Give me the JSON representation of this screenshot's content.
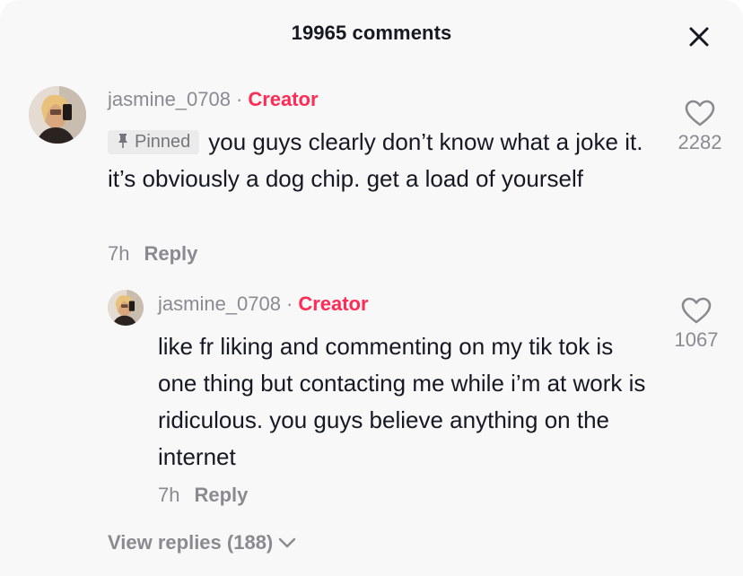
{
  "header": {
    "title": "19965 comments",
    "close_icon": "close-icon"
  },
  "comments": [
    {
      "username": "jasmine_0708",
      "separator": "·",
      "role": "Creator",
      "pinned_label": "Pinned",
      "text": "you guys clearly don’t know what a joke it. it’s obviously a dog chip. get a load of yourself",
      "time": "7h",
      "reply_label": "Reply",
      "likes": "2282"
    }
  ],
  "reply": {
    "username": "jasmine_0708",
    "separator": "·",
    "role": "Creator",
    "text": "like fr liking and commenting on my tik tok is one thing but contacting me while i’m at work is ridiculous. you guys believe anything on the internet",
    "time": "7h",
    "reply_label": "Reply",
    "likes": "1067"
  },
  "view_replies": {
    "label": "View replies (188)"
  },
  "colors": {
    "creator": "#fe2c55",
    "muted": "#8a8b91",
    "text": "#161823",
    "background": "#f8f8f8"
  }
}
